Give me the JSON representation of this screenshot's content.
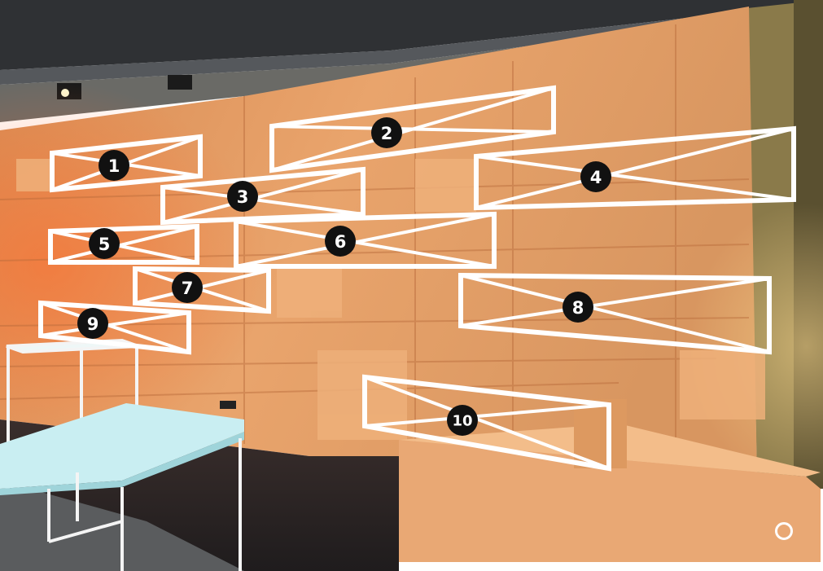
{
  "panels": [
    {
      "label": "1"
    },
    {
      "label": "2"
    },
    {
      "label": "3"
    },
    {
      "label": "4"
    },
    {
      "label": "5"
    },
    {
      "label": "6"
    },
    {
      "label": "7"
    },
    {
      "label": "8"
    },
    {
      "label": "9"
    },
    {
      "label": "10"
    }
  ],
  "colors": {
    "plywood": "#e39a62",
    "plywood_light": "#f0b27c",
    "plywood_dark": "#c97a45",
    "orange_light": "#ff7a3a",
    "ceiling": "#3b3d40",
    "floor": "#2b2627",
    "table_top": "#c7eef2",
    "outline": "#ffffff",
    "badge": "#111111"
  },
  "control": {
    "icon": "circle-outline-icon"
  }
}
